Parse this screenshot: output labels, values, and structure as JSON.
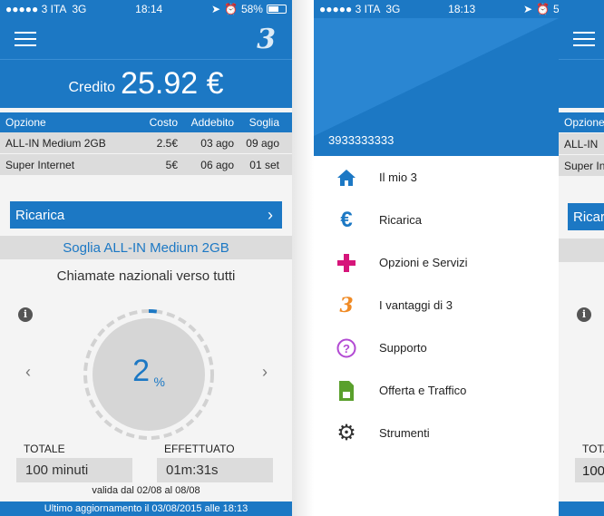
{
  "status": {
    "carrier_left": "●●●●● 3 ITA",
    "network": "3G",
    "time_1": "18:14",
    "time_2": "18:13",
    "battery": "58%"
  },
  "screen1": {
    "credit_label": "Credito",
    "credit_value": "25.92 €",
    "options_header": [
      "Opzione",
      "Costo",
      "Addebito",
      "Soglia"
    ],
    "options_rows": [
      [
        "ALL-IN Medium 2GB",
        "2.5€",
        "03 ago",
        "09 ago"
      ],
      [
        "Super Internet",
        "5€",
        "06 ago",
        "01 set"
      ]
    ],
    "ricarica_label": "Ricarica",
    "soglia_title": "Soglia ALL-IN Medium 2GB",
    "gauge_title": "Chiamate nazionali verso tutti",
    "gauge_value": "2",
    "gauge_unit": "%",
    "gauge_fraction": 0.02,
    "totale_label": "TOTALE",
    "totale_value": "100 minuti",
    "effettuato_label": "EFFETTUATO",
    "effettuato_value": "01m:31s",
    "validity": "valida dal 02/08 al 08/08",
    "footer": "Ultimo aggiornamento il 03/08/2015 alle 18:13"
  },
  "menu": {
    "phone_number": "3933333333",
    "items": [
      {
        "label": "Il mio 3",
        "icon": "home-icon",
        "has_caret": false
      },
      {
        "label": "Ricarica",
        "icon": "euro-icon",
        "has_caret": false
      },
      {
        "label": "Opzioni e Servizi",
        "icon": "plus-icon",
        "has_caret": false
      },
      {
        "label": "I vantaggi di 3",
        "icon": "logo-3-icon",
        "has_caret": true
      },
      {
        "label": "Supporto",
        "icon": "help-icon",
        "has_caret": true
      },
      {
        "label": "Offerta e Traffico",
        "icon": "sim-icon",
        "has_caret": true
      },
      {
        "label": "Strumenti",
        "icon": "gear-icon",
        "has_caret": true
      }
    ]
  },
  "screen3_peek": {
    "opzione": "Opzione",
    "row1": "ALL-IN",
    "row2": "Super In",
    "ricarica": "Ricar",
    "tota": "TOTA",
    "val": "100"
  },
  "colors": {
    "brand_blue": "#1c78c4",
    "row_gray": "#dcdcdc",
    "plus_magenta": "#d6157a",
    "logo_orange": "#f08a24",
    "help_purple": "#b24ad3",
    "sim_green": "#5aa02c"
  }
}
